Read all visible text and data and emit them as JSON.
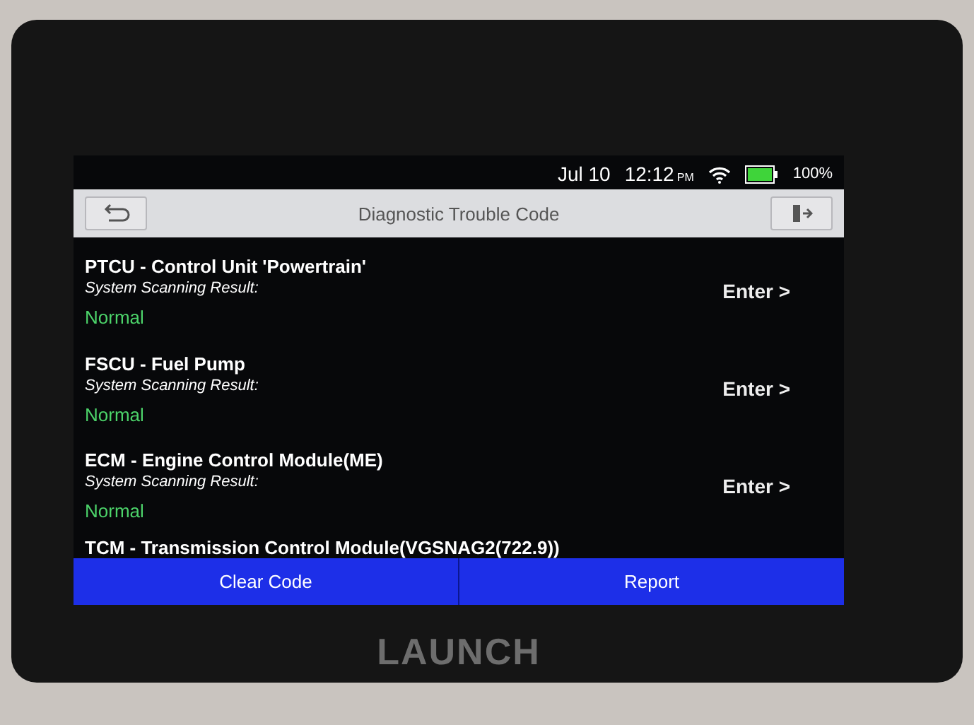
{
  "status_bar": {
    "date": "Jul 10",
    "time": "12:12",
    "meridiem": "PM",
    "battery": "100%",
    "level": 1
  },
  "title_bar": {
    "title": "Diagnostic Trouble Code"
  },
  "systems": [
    {
      "name": "PTCU - Control Unit 'Powertrain'",
      "result_label": "System Scanning Result:",
      "result": "Normal",
      "action": "Enter >"
    },
    {
      "name": "FSCU - Fuel Pump",
      "result_label": "System Scanning Result:",
      "result": "Normal",
      "action": "Enter >"
    },
    {
      "name": "ECM - Engine Control Module(ME)",
      "result_label": "System Scanning Result:",
      "result": "Normal",
      "action": "Enter >"
    },
    {
      "name": "TCM - Transmission Control Module(VGSNAG2(722.9))"
    }
  ],
  "buttons": [
    "Clear Code",
    "Report"
  ],
  "device": {
    "brand": "LAUNCH"
  }
}
